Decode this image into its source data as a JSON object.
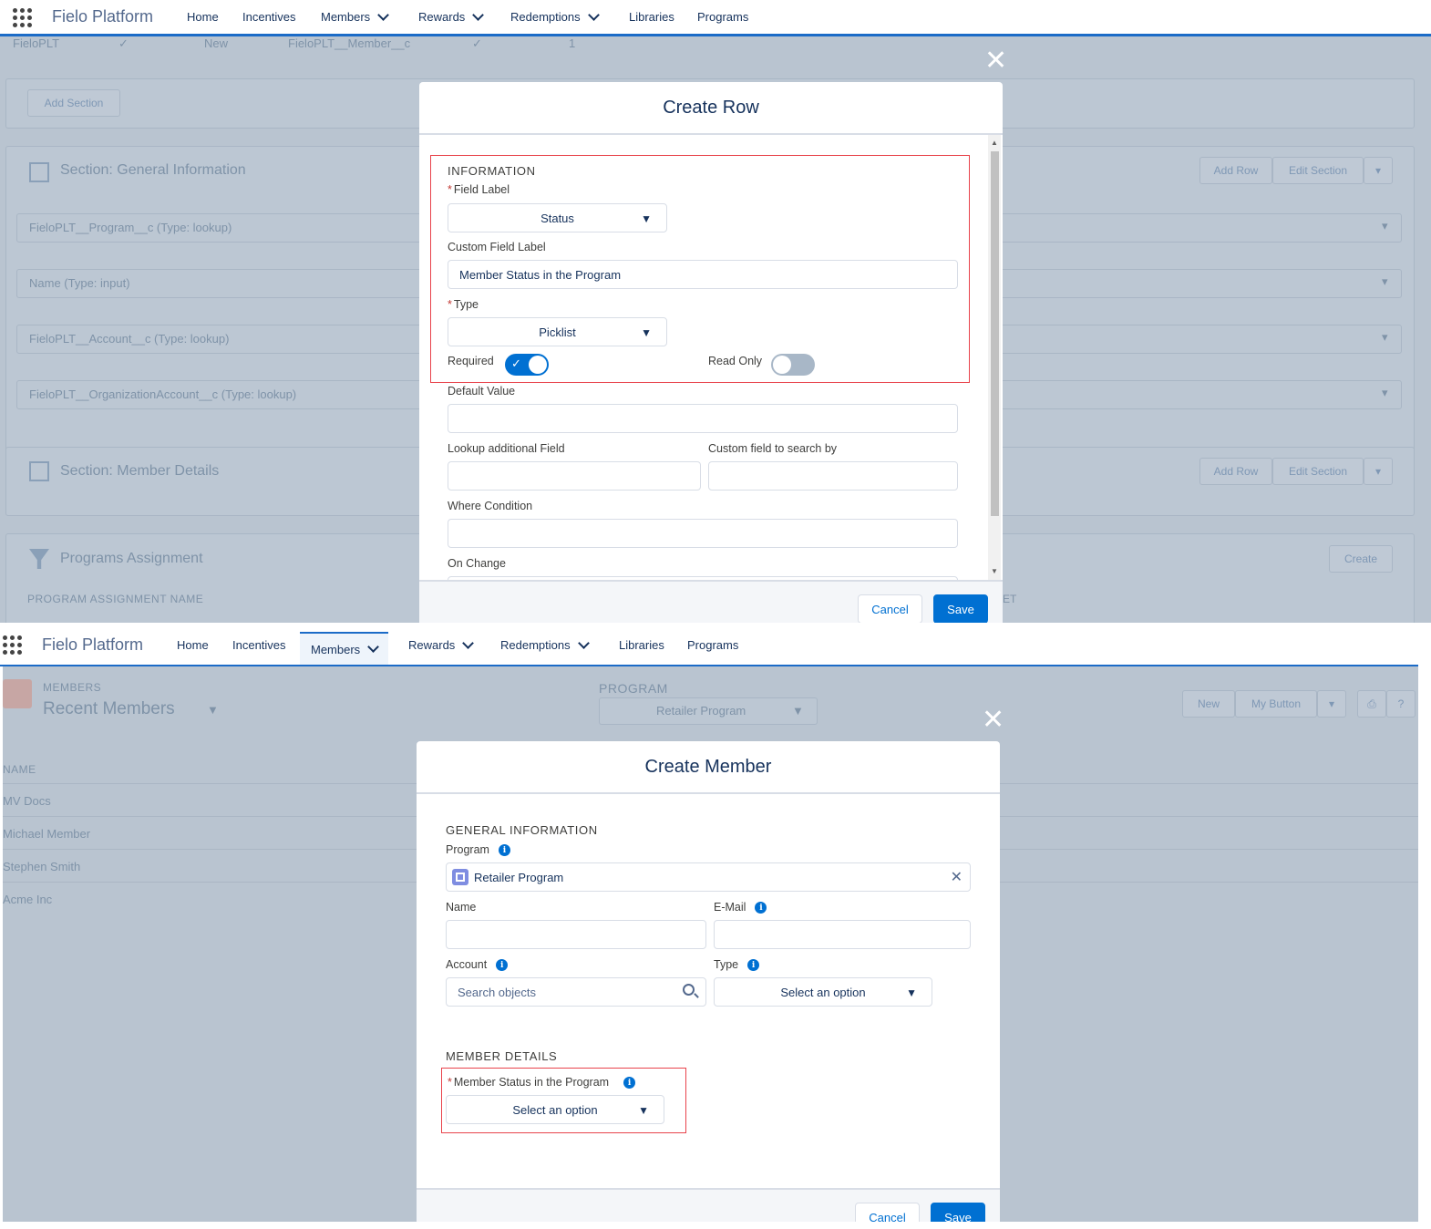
{
  "top_panel": {
    "nav": {
      "app_name": "Fielo Platform",
      "items": [
        "Home",
        "Incentives",
        "Members",
        "Rewards",
        "Redemptions",
        "Libraries",
        "Programs"
      ]
    },
    "background": {
      "row_cells": [
        "FieloPLT",
        "New",
        "FieloPLT__Member__c",
        "1"
      ],
      "add_section": "Add Section",
      "section_general": "Section: General Information",
      "section_member_details": "Section: Member Details",
      "add_row": "Add Row",
      "edit_section": "Edit Section",
      "fields": [
        "FieloPLT__Program__c (Type: lookup)",
        "Name (Type: input)",
        "FieloPLT__Account__c (Type: lookup)",
        "FieloPLT__OrganizationAccount__c (Type: lookup)"
      ],
      "programs_assignment": "Programs Assignment",
      "create": "Create",
      "col_header": "PROGRAM ASSIGNMENT NAME",
      "col_header_right": "ET"
    },
    "modal": {
      "title": "Create Row",
      "section_title": "INFORMATION",
      "field_label_label": "Field Label",
      "field_label_value": "Status",
      "custom_field_label_label": "Custom Field Label",
      "custom_field_label_value": "Member Status in the Program",
      "type_label": "Type",
      "type_value": "Picklist",
      "required_label": "Required",
      "required_on": true,
      "read_only_label": "Read Only",
      "read_only_on": false,
      "default_value_label": "Default Value",
      "lookup_additional_label": "Lookup additional Field",
      "custom_search_label": "Custom field to search by",
      "where_condition_label": "Where Condition",
      "on_change_label": "On Change",
      "cancel": "Cancel",
      "save": "Save"
    }
  },
  "bottom_panel": {
    "nav": {
      "app_name": "Fielo Platform",
      "items": [
        "Home",
        "Incentives",
        "Members",
        "Rewards",
        "Redemptions",
        "Libraries",
        "Programs"
      ],
      "active": "Members"
    },
    "background": {
      "object_label": "MEMBERS",
      "list_view": "Recent Members",
      "program_label": "PROGRAM",
      "program_value": "Retailer Program",
      "new": "New",
      "my_button": "My Button",
      "name_header": "NAME",
      "rows": [
        "MV Docs",
        "Michael Member",
        "Stephen Smith",
        "Acme Inc"
      ]
    },
    "modal": {
      "title": "Create Member",
      "general_section": "GENERAL INFORMATION",
      "program_label": "Program",
      "program_value": "Retailer Program",
      "name_label": "Name",
      "email_label": "E-Mail",
      "account_label": "Account",
      "account_placeholder": "Search objects",
      "type_label": "Type",
      "type_value": "Select an option",
      "details_section": "MEMBER DETAILS",
      "status_label": "Member Status in the Program",
      "status_value": "Select an option",
      "cancel": "Cancel",
      "save": "Save"
    }
  },
  "colors": {
    "brand": "#0070d2",
    "nav_border": "#1b6bc7",
    "highlight_box": "#e8434b",
    "backdrop": "#b9c4d0"
  }
}
